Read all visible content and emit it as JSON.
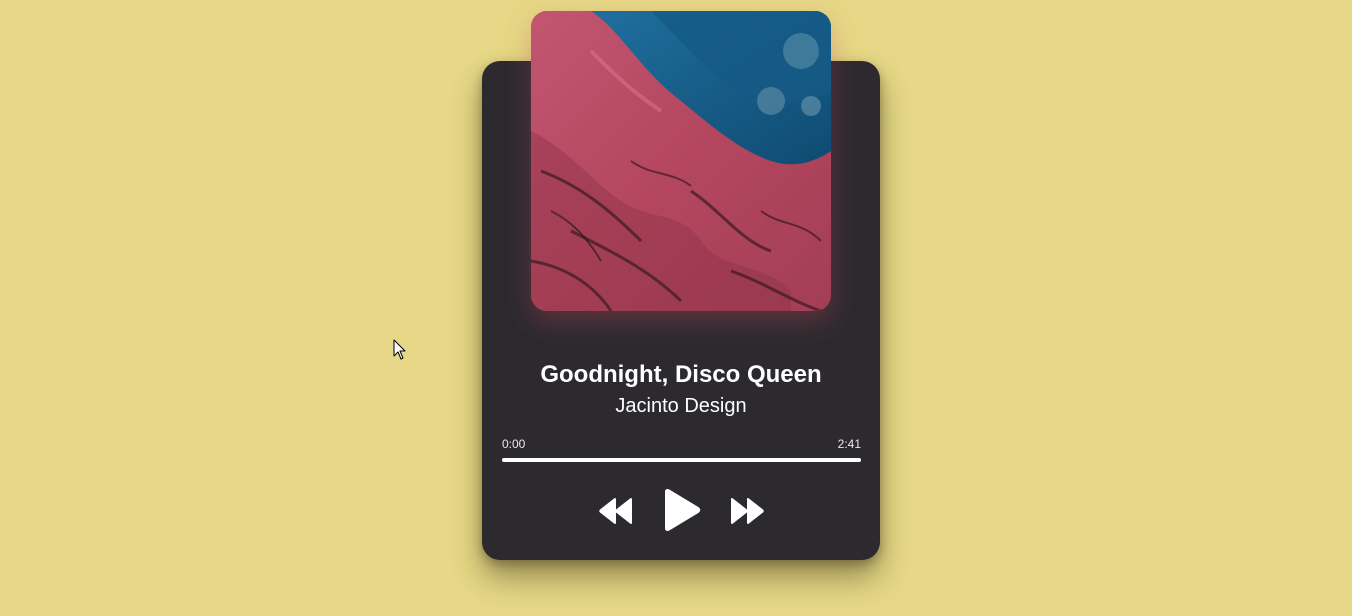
{
  "track": {
    "title": "Goodnight, Disco Queen",
    "artist": "Jacinto Design"
  },
  "playback": {
    "current_time": "0:00",
    "duration": "2:41",
    "progress_fraction": 1.0
  },
  "controls": {
    "rewind_icon": "rewind-icon",
    "play_icon": "play-icon",
    "forward_icon": "fast-forward-icon"
  },
  "colors": {
    "background": "#e6d886",
    "card": "#2c2a2f",
    "text": "#ffffff",
    "progress_fill": "#ffffff"
  }
}
